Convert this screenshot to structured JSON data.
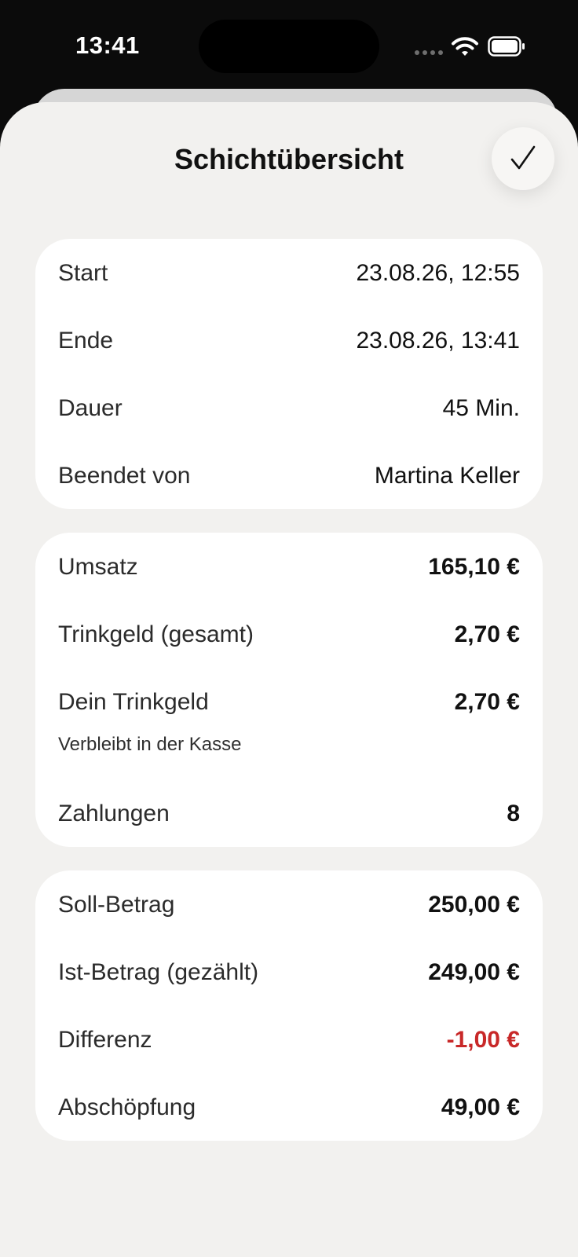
{
  "status_bar": {
    "time": "13:41"
  },
  "header": {
    "title": "Schichtübersicht",
    "done_icon": "checkmark-icon"
  },
  "shift_card": {
    "rows": [
      {
        "label": "Start",
        "value": "23.08.26, 12:55"
      },
      {
        "label": "Ende",
        "value": "23.08.26, 13:41"
      },
      {
        "label": "Dauer",
        "value": "45 Min."
      },
      {
        "label": "Beendet von",
        "value": "Martina Keller"
      }
    ]
  },
  "sales_card": {
    "rows": [
      {
        "label": "Umsatz",
        "value": "165,10 €"
      },
      {
        "label": "Trinkgeld (gesamt)",
        "value": "2,70 €"
      },
      {
        "label": "Dein Trinkgeld",
        "value": "2,70 €"
      },
      {
        "label": "Zahlungen",
        "value": "8"
      }
    ],
    "tip_note": "Verbleibt in der Kasse"
  },
  "cash_card": {
    "rows": [
      {
        "label": "Soll-Betrag",
        "value": "250,00 €"
      },
      {
        "label": "Ist-Betrag (gezählt)",
        "value": "249,00 €"
      },
      {
        "label": "Differenz",
        "value": "-1,00 €"
      },
      {
        "label": "Abschöpfung",
        "value": "49,00 €"
      }
    ]
  },
  "colors": {
    "negative": "#c82828",
    "sheet_background": "#f2f1ef",
    "card_background": "#ffffff"
  }
}
